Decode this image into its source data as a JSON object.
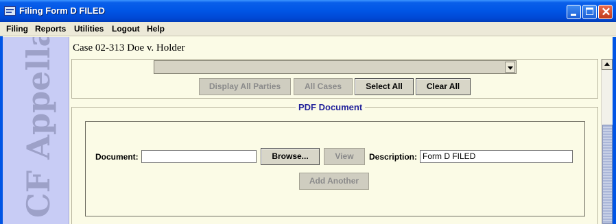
{
  "window": {
    "title": "Filing Form D FILED",
    "close_symbol": "✕"
  },
  "menu": {
    "items": [
      "Filing",
      "Reports",
      "Utilities",
      "Logout",
      "Help"
    ]
  },
  "banner": {
    "text": "CF Appellate"
  },
  "case": {
    "title": "Case 02-313 Doe v. Holder"
  },
  "party_panel": {
    "dropdown_value": "",
    "buttons": {
      "display_all_parties": "Display All Parties",
      "all_cases": "All Cases",
      "select_all": "Select All",
      "clear_all": "Clear All"
    }
  },
  "pdf_panel": {
    "title": "PDF Document",
    "document_label": "Document:",
    "document_value": "",
    "browse_label": "Browse...",
    "view_label": "View",
    "description_label": "Description:",
    "description_value": "Form D FILED",
    "add_another_label": "Add Another"
  },
  "colors": {
    "titlebar": "#0055e5",
    "menubar": "#ece9d8",
    "content_bg": "#fbfbe6",
    "banner_bg": "#c8ccf5",
    "panel_title": "#23239b"
  }
}
